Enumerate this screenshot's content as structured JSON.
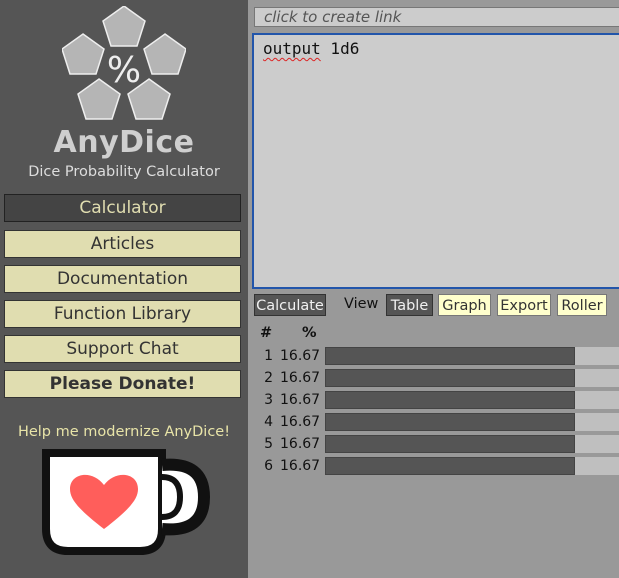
{
  "app": {
    "title": "AnyDice",
    "subtitle": "Dice Probability Calculator",
    "logo_symbol": "%"
  },
  "nav": {
    "items": [
      {
        "label": "Calculator",
        "active": true
      },
      {
        "label": "Articles"
      },
      {
        "label": "Documentation"
      },
      {
        "label": "Function Library"
      },
      {
        "label": "Support Chat"
      },
      {
        "label": "Please Donate!",
        "bold": true
      }
    ]
  },
  "promo": {
    "text": "Help me modernize AnyDice!",
    "icon": "ko-fi-cup-heart-icon"
  },
  "link_bar": {
    "placeholder": "click to create link"
  },
  "editor": {
    "code_keyword": "output",
    "code_rest": " 1d6"
  },
  "toolbar": {
    "calculate_label": "Calculate",
    "view_label": "View",
    "view_options": [
      {
        "label": "Table",
        "selected": true
      },
      {
        "label": "Graph"
      },
      {
        "label": "Export"
      },
      {
        "label": "Roller"
      }
    ]
  },
  "results": {
    "headers": [
      "#",
      "%"
    ],
    "rows": [
      {
        "value": "1",
        "percent": "16.67"
      },
      {
        "value": "2",
        "percent": "16.67"
      },
      {
        "value": "3",
        "percent": "16.67"
      },
      {
        "value": "4",
        "percent": "16.67"
      },
      {
        "value": "5",
        "percent": "16.67"
      },
      {
        "value": "6",
        "percent": "16.67"
      }
    ],
    "bar_fill_fraction": 0.85
  },
  "colors": {
    "sidebar_bg": "#555555",
    "nav_button_bg": "#e0ddb0",
    "active_nav_bg": "#444444",
    "editor_bg": "#cccccc",
    "editor_border": "#2255aa",
    "bar_fill": "#555555",
    "bar_track": "#bfbfbf",
    "promo_text": "#e8e4a8",
    "heart": "#ff5e5b"
  }
}
